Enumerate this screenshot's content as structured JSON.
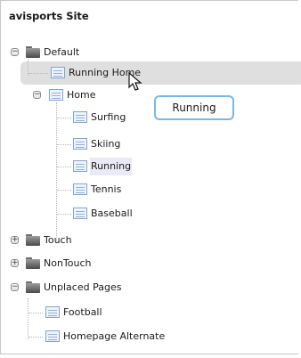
{
  "site_title": "avisports Site",
  "tree": {
    "default": {
      "label": "Default"
    },
    "running_home": {
      "label": "Running Home"
    },
    "home": {
      "label": "Home"
    },
    "surfing": {
      "label": "Surfing"
    },
    "skiing": {
      "label": "Skiing"
    },
    "running": {
      "label": "Running"
    },
    "tennis": {
      "label": "Tennis"
    },
    "baseball": {
      "label": "Baseball"
    },
    "touch": {
      "label": "Touch"
    },
    "nontouch": {
      "label": "NonTouch"
    },
    "unplaced": {
      "label": "Unplaced Pages"
    },
    "football": {
      "label": "Football"
    },
    "homepage_alternate": {
      "label": "Homepage Alternate"
    }
  },
  "drag_tooltip": "Running",
  "expander": {
    "expanded": "−",
    "collapsed": "+"
  },
  "colors": {
    "selection": "#dfdfdf",
    "drag_border": "#7bb7e6",
    "folder": "#6d6d6d",
    "page_icon": "#7fa6cf"
  }
}
